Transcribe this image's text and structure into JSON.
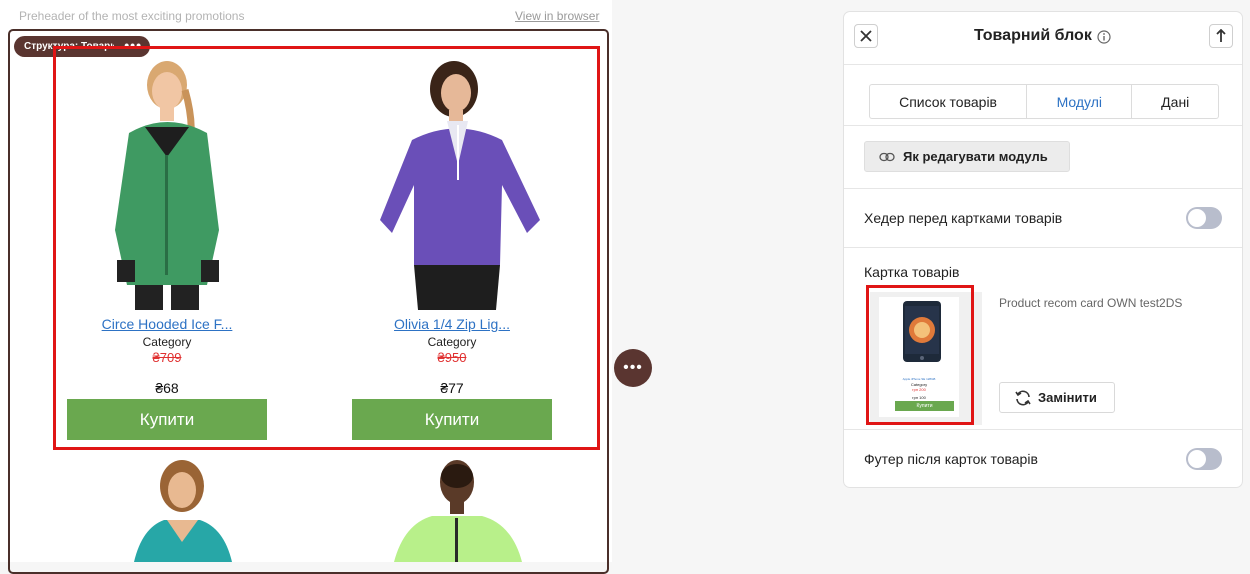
{
  "canvas": {
    "preheader": "Preheader of the most exciting promotions",
    "view_in_browser": "View in browser",
    "structure_tag": "Структура: Товари",
    "structure_tag_menu": "•••",
    "products": [
      {
        "name": "Circe Hooded Ice F...",
        "category": "Category",
        "old_price": "₴709",
        "price": "₴68",
        "buy_label": "Купити",
        "shirt_color": "#3f9a62"
      },
      {
        "name": "Olivia 1/4 Zip Lig...",
        "category": "Category",
        "old_price": "₴950",
        "price": "₴77",
        "buy_label": "Купити",
        "shirt_color": "#6a4fb8"
      }
    ],
    "more_button": "•••"
  },
  "panel": {
    "title": "Товарний блок",
    "tabs": [
      {
        "label": "Список товарів",
        "active": false
      },
      {
        "label": "Модулі",
        "active": true
      },
      {
        "label": "Дані",
        "active": false
      }
    ],
    "how_to_edit": "Як редагувати модуль",
    "header_toggle_label": "Хедер перед картками товарів",
    "card_section_label": "Картка товарів",
    "card_name": "Product recom card OWN test2DS",
    "thumb": {
      "name": "Apple iPhone SE 128GB",
      "category": "Category",
      "old_price": "грн 200",
      "price": "грн 100",
      "buy_label": "Купити"
    },
    "replace_label": "Замінити",
    "footer_toggle_label": "Футер після карток товарів"
  },
  "colors": {
    "buy_green": "#6aa84f",
    "link_blue": "#2d72c4",
    "selection_red": "#e01515",
    "structure_brown": "#5a3530"
  }
}
